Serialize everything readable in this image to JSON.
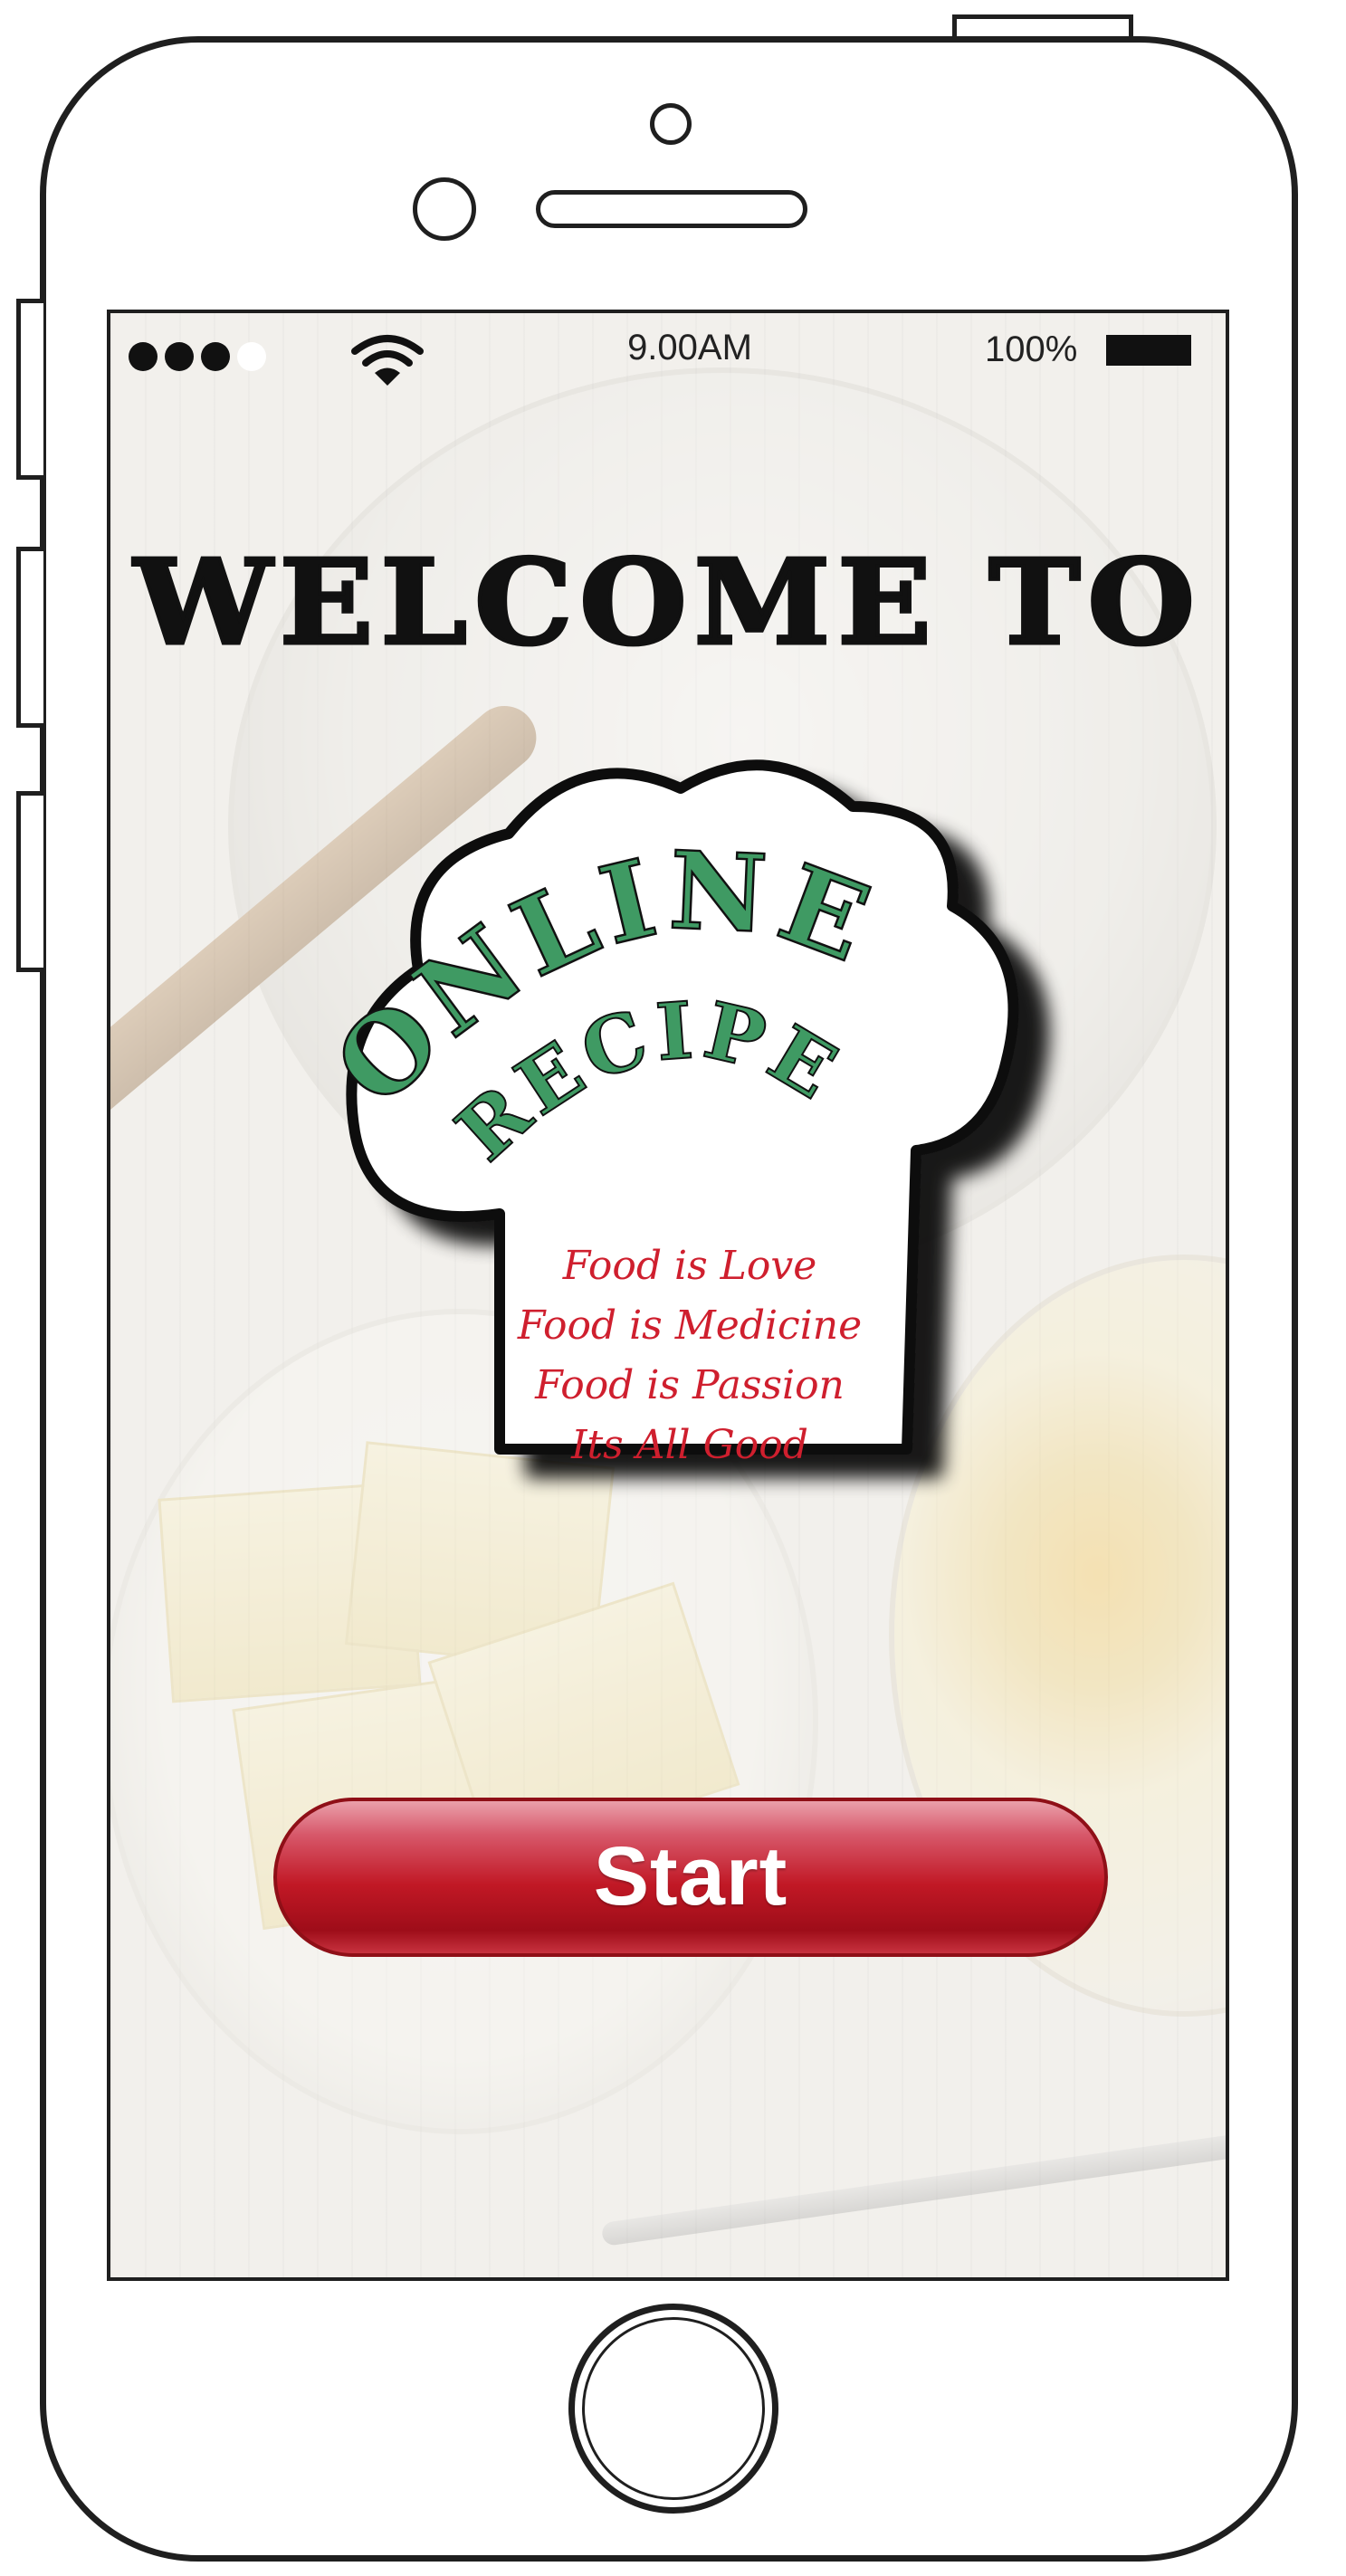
{
  "status_bar": {
    "signal_icon": "signal-dots-icon",
    "wifi_icon": "wifi-icon",
    "time": "9.00AM",
    "battery_percent": "100%",
    "battery_icon": "battery-icon",
    "battery_level": 1.0
  },
  "welcome": {
    "heading": "WELCOME TO"
  },
  "logo": {
    "line1": "ONLINE",
    "line2": "RECIPE",
    "taglines": [
      "Food is Love",
      "Food is Medicine",
      "Food is Passion",
      "Its All Good"
    ],
    "colors": {
      "logo_text": "#3f9a63",
      "tagline": "#cf1f2e"
    }
  },
  "start_button": {
    "label": "Start",
    "color": "#c11825"
  }
}
